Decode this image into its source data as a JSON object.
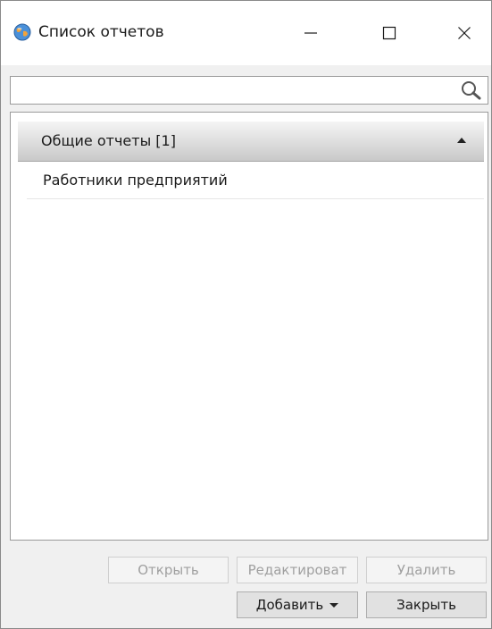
{
  "window": {
    "title": "Список отчетов",
    "minimize_icon": "minimize-icon",
    "maximize_icon": "maximize-icon",
    "close_icon": "close-icon"
  },
  "search": {
    "value": "",
    "placeholder": "",
    "icon": "search-icon"
  },
  "groups": [
    {
      "title": "Общие отчеты [1]",
      "expanded": true,
      "items": [
        {
          "label": "Работники предприятий"
        }
      ]
    }
  ],
  "buttons": {
    "open": {
      "label": "Открыть",
      "enabled": false
    },
    "edit": {
      "label": "Редактироват",
      "enabled": false
    },
    "delete": {
      "label": "Удалить",
      "enabled": false
    },
    "add": {
      "label": "Добавить",
      "enabled": true
    },
    "close": {
      "label": "Закрыть",
      "enabled": true
    }
  }
}
